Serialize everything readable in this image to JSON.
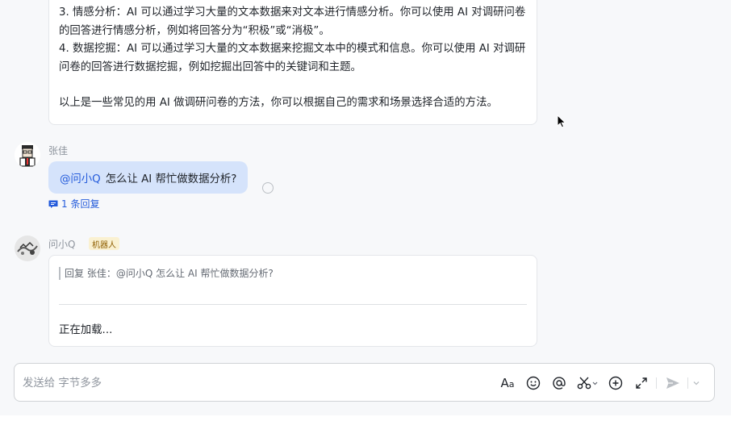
{
  "history_message": {
    "lines": [
      "3. 情感分析：AI 可以通过学习大量的文本数据来对文本进行情感分析。你可以使用 AI 对调研问卷的回答进行情感分析，例如将回答分为“积极”或“消极”。",
      "4. 数据挖掘：AI 可以通过学习大量的文本数据来挖掘文本中的模式和信息。你可以使用 AI 对调研问卷的回答进行数据挖掘，例如挖掘出回答中的关键词和主题。"
    ],
    "closing": "以上是一些常见的用 AI 做调研问卷的方法，你可以根据自己的需求和场景选择合适的方法。"
  },
  "user_message": {
    "sender": "张佳",
    "mention": "@问小Q",
    "text": "怎么让 AI 帮忙做数据分析?",
    "reply_count": "1 条回复"
  },
  "bot_message": {
    "sender": "问小Q",
    "tag": "机器人",
    "quote": "回复 张佳：@问小Q 怎么让 AI 帮忙做数据分析?",
    "status": "正在加载..."
  },
  "composer": {
    "placeholder": "发送给 字节多多",
    "tools": [
      "format-text-icon",
      "emoji-icon",
      "mention-icon",
      "screenshot-icon",
      "add-icon",
      "expand-icon",
      "send-icon"
    ]
  },
  "colors": {
    "accent": "#245bdb",
    "user_bubble": "#d5e3fb",
    "bot_tag_bg": "#faf1d1"
  }
}
